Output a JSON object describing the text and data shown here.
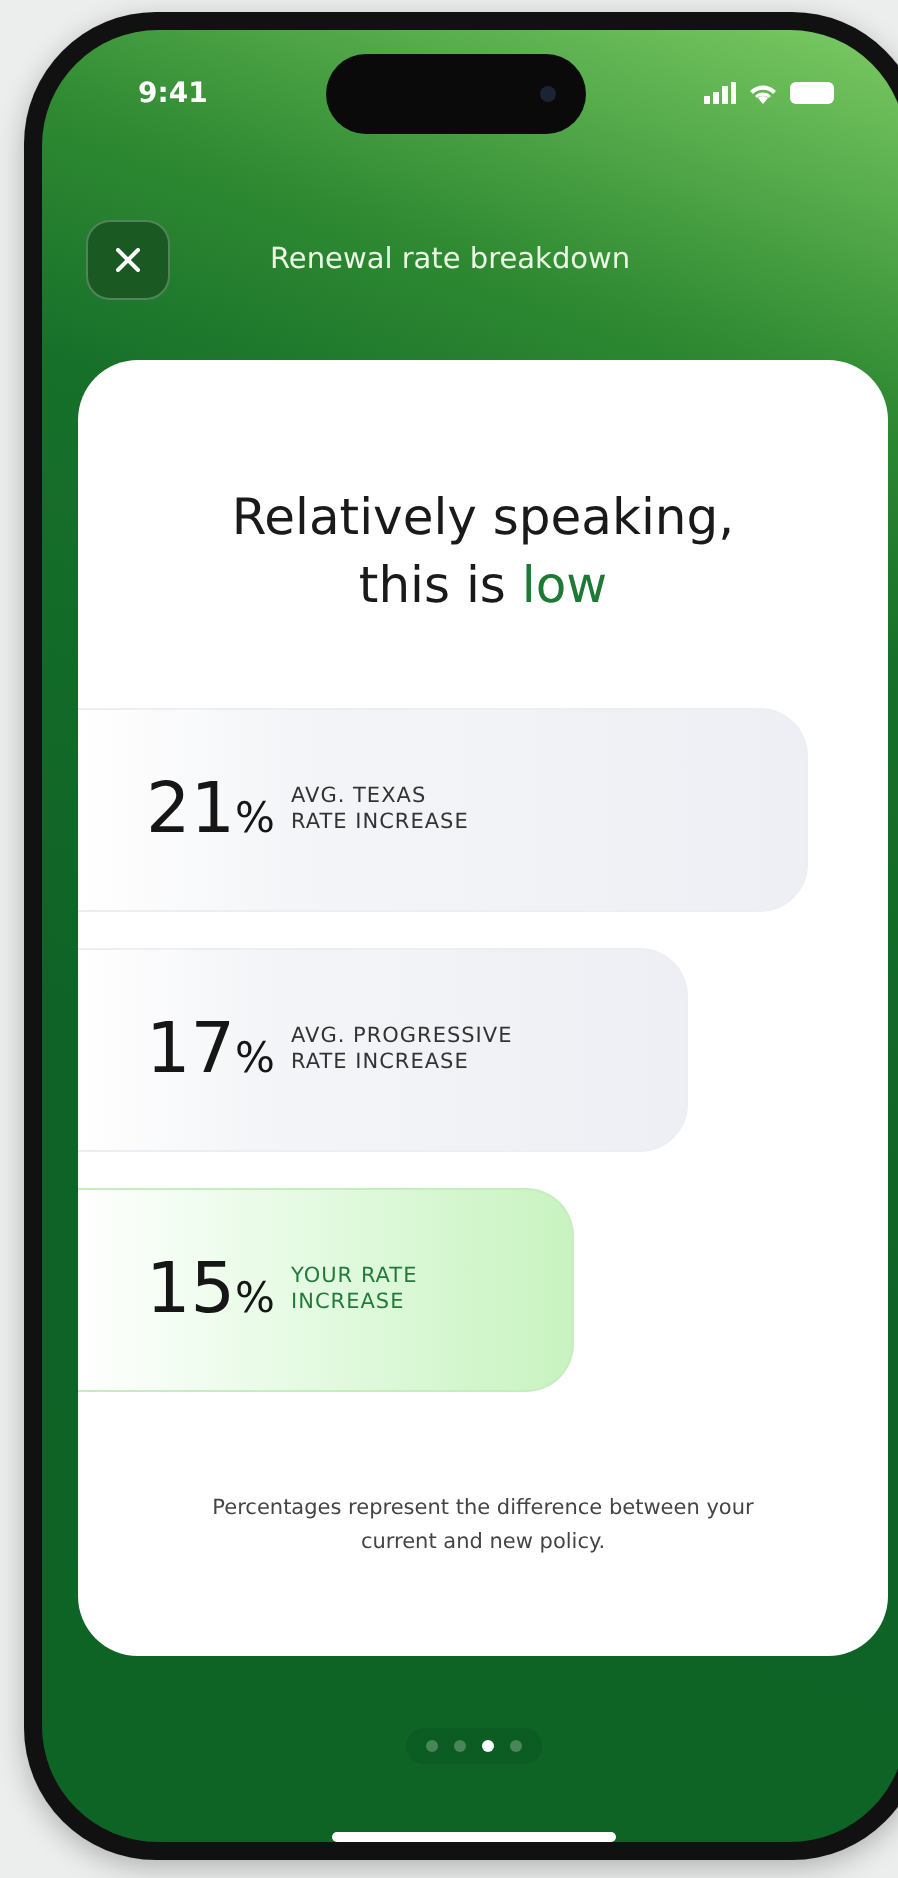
{
  "status_bar": {
    "time": "9:41"
  },
  "header": {
    "title": "Renewal rate breakdown"
  },
  "card": {
    "title": "Relatively speaking, this is",
    "title_highlight": "low",
    "rows": [
      {
        "value": "21",
        "unit": "%",
        "label_lines": [
          "AVG. TEXAS",
          "RATE INCREASE"
        ],
        "highlighted": false
      },
      {
        "value": "17",
        "unit": "%",
        "label_lines": [
          "AVG. PROGRESSIVE",
          "RATE INCREASE"
        ],
        "highlighted": false
      },
      {
        "value": "15",
        "unit": "%",
        "label_lines": [
          "YOUR RATE",
          "INCREASE"
        ],
        "highlighted": true
      }
    ],
    "footnote": "Percentages represent the difference between your current and new policy."
  },
  "pager": [
    {
      "selected": false
    },
    {
      "selected": false
    },
    {
      "selected": true
    },
    {
      "selected": false
    }
  ]
}
